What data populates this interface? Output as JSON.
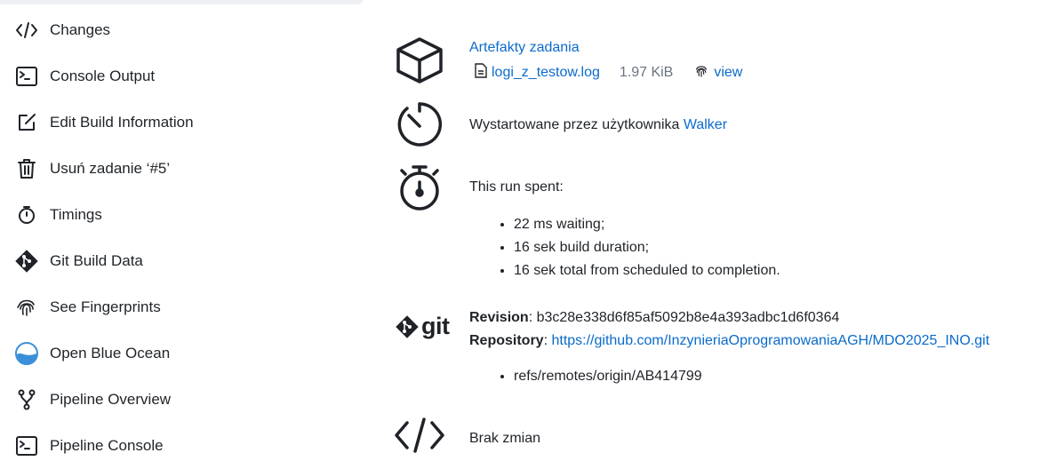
{
  "sidebar": {
    "items": [
      {
        "label": "Changes",
        "icon": "code-icon"
      },
      {
        "label": "Console Output",
        "icon": "terminal-icon"
      },
      {
        "label": "Edit Build Information",
        "icon": "edit-icon"
      },
      {
        "label": "Usuń zadanie ‘#5’",
        "icon": "trash-icon"
      },
      {
        "label": "Timings",
        "icon": "stopwatch-icon"
      },
      {
        "label": "Git Build Data",
        "icon": "git-icon"
      },
      {
        "label": "See Fingerprints",
        "icon": "fingerprint-icon"
      },
      {
        "label": "Open Blue Ocean",
        "icon": "blue-ocean-icon"
      },
      {
        "label": "Pipeline Overview",
        "icon": "pipeline-icon"
      },
      {
        "label": "Pipeline Console",
        "icon": "terminal-icon"
      }
    ]
  },
  "artifacts": {
    "title": "Artefakty zadania",
    "file_name": "logi_z_testow.log",
    "file_size": "1.97 KiB",
    "view_label": "view"
  },
  "started": {
    "prefix": "Wystartowane przez użytkownika",
    "user": "Walker"
  },
  "timing": {
    "heading": "This run spent:",
    "items": [
      "22 ms waiting;",
      "16 sek build duration;",
      "16 sek total from scheduled to completion."
    ]
  },
  "git": {
    "logo_text": "git",
    "revision_label": "Revision",
    "revision_value": "b3c28e338d6f85af5092b8e4a393adbc1d6f0364",
    "repository_label": "Repository",
    "repository_url": "https://github.com/InzynieriaOprogramowaniaAGH/MDO2025_INO.git",
    "refs": [
      "refs/remotes/origin/AB414799"
    ]
  },
  "changes": {
    "text": "Brak zmian"
  },
  "colors": {
    "link": "#0b6bcb",
    "blue_ocean": "#3b8fd9"
  }
}
